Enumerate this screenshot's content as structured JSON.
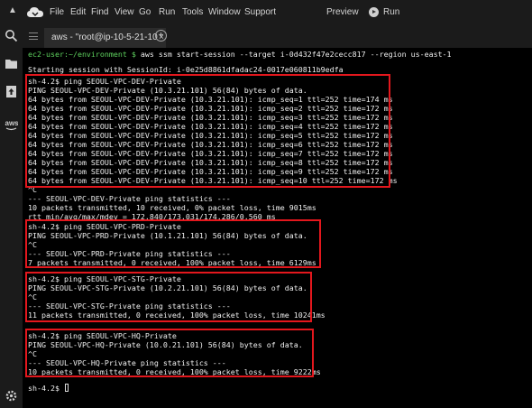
{
  "menubar": {
    "collapse_glyph": "▲",
    "items": [
      "File",
      "Edit",
      "Find",
      "View",
      "Go",
      "Run",
      "Tools",
      "Window",
      "Support"
    ],
    "preview": "Preview",
    "run": "Run"
  },
  "sidebar": {
    "icons": [
      "search-icon",
      "folder-icon",
      "upload-icon",
      "aws-logo",
      "settings-icon"
    ],
    "aws_text": "aws"
  },
  "tabs": [
    {
      "label": "aws - \"root@ip-10-5-21-10",
      "close_glyph": "×"
    }
  ],
  "add_tab_glyph": "+",
  "terminal": {
    "prompt": "ec2-user:~/environment $",
    "command": " aws ssm start-session --target i-0d432f47e2cecc817 --region us-east-1",
    "lines": [
      "Starting session with SessionId: i-0e25d8861dfadac24-0017e060811b9edfa",
      "sh-4.2$ ping SEOUL-VPC-DEV-Private",
      "PING SEOUL-VPC-DEV-Private (10.3.21.101) 56(84) bytes of data.",
      "64 bytes from SEOUL-VPC-DEV-Private (10.3.21.101): icmp_seq=1 ttl=252 time=174 ms",
      "64 bytes from SEOUL-VPC-DEV-Private (10.3.21.101): icmp_seq=2 ttl=252 time=172 ms",
      "64 bytes from SEOUL-VPC-DEV-Private (10.3.21.101): icmp_seq=3 ttl=252 time=172 ms",
      "64 bytes from SEOUL-VPC-DEV-Private (10.3.21.101): icmp_seq=4 ttl=252 time=172 ms",
      "64 bytes from SEOUL-VPC-DEV-Private (10.3.21.101): icmp_seq=5 ttl=252 time=172 ms",
      "64 bytes from SEOUL-VPC-DEV-Private (10.3.21.101): icmp_seq=6 ttl=252 time=172 ms",
      "64 bytes from SEOUL-VPC-DEV-Private (10.3.21.101): icmp_seq=7 ttl=252 time=172 ms",
      "64 bytes from SEOUL-VPC-DEV-Private (10.3.21.101): icmp_seq=8 ttl=252 time=172 ms",
      "64 bytes from SEOUL-VPC-DEV-Private (10.3.21.101): icmp_seq=9 ttl=252 time=172 ms",
      "64 bytes from SEOUL-VPC-DEV-Private (10.3.21.101): icmp_seq=10 ttl=252 time=172 ms",
      "^C",
      "--- SEOUL-VPC-DEV-Private ping statistics ---",
      "10 packets transmitted, 10 received, 0% packet loss, time 9015ms",
      "rtt min/avg/max/mdev = 172.840/173.031/174.286/0.560 ms",
      "sh-4.2$ ping SEOUL-VPC-PRD-Private",
      "PING SEOUL-VPC-PRD-Private (10.1.21.101) 56(84) bytes of data.",
      "^C",
      "--- SEOUL-VPC-PRD-Private ping statistics ---",
      "7 packets transmitted, 0 received, 100% packet loss, time 6129ms",
      "sh-4.2$ ping SEOUL-VPC-STG-Private",
      "PING SEOUL-VPC-STG-Private (10.2.21.101) 56(84) bytes of data.",
      "^C",
      "--- SEOUL-VPC-STG-Private ping statistics ---",
      "11 packets transmitted, 0 received, 100% packet loss, time 10241ms",
      "sh-4.2$ ping SEOUL-VPC-HQ-Private",
      "PING SEOUL-VPC-HQ-Private (10.0.21.101) 56(84) bytes of data.",
      "^C",
      "--- SEOUL-VPC-HQ-Private ping statistics ---",
      "10 packets transmitted, 0 received, 100% packet loss, time 9222ms"
    ],
    "final_prompt": "sh-4.2$ "
  },
  "colors": {
    "highlight_box": "#e3171d",
    "prompt_green": "#5fd35f",
    "background": "#000000",
    "chrome": "#1b1b1b"
  }
}
